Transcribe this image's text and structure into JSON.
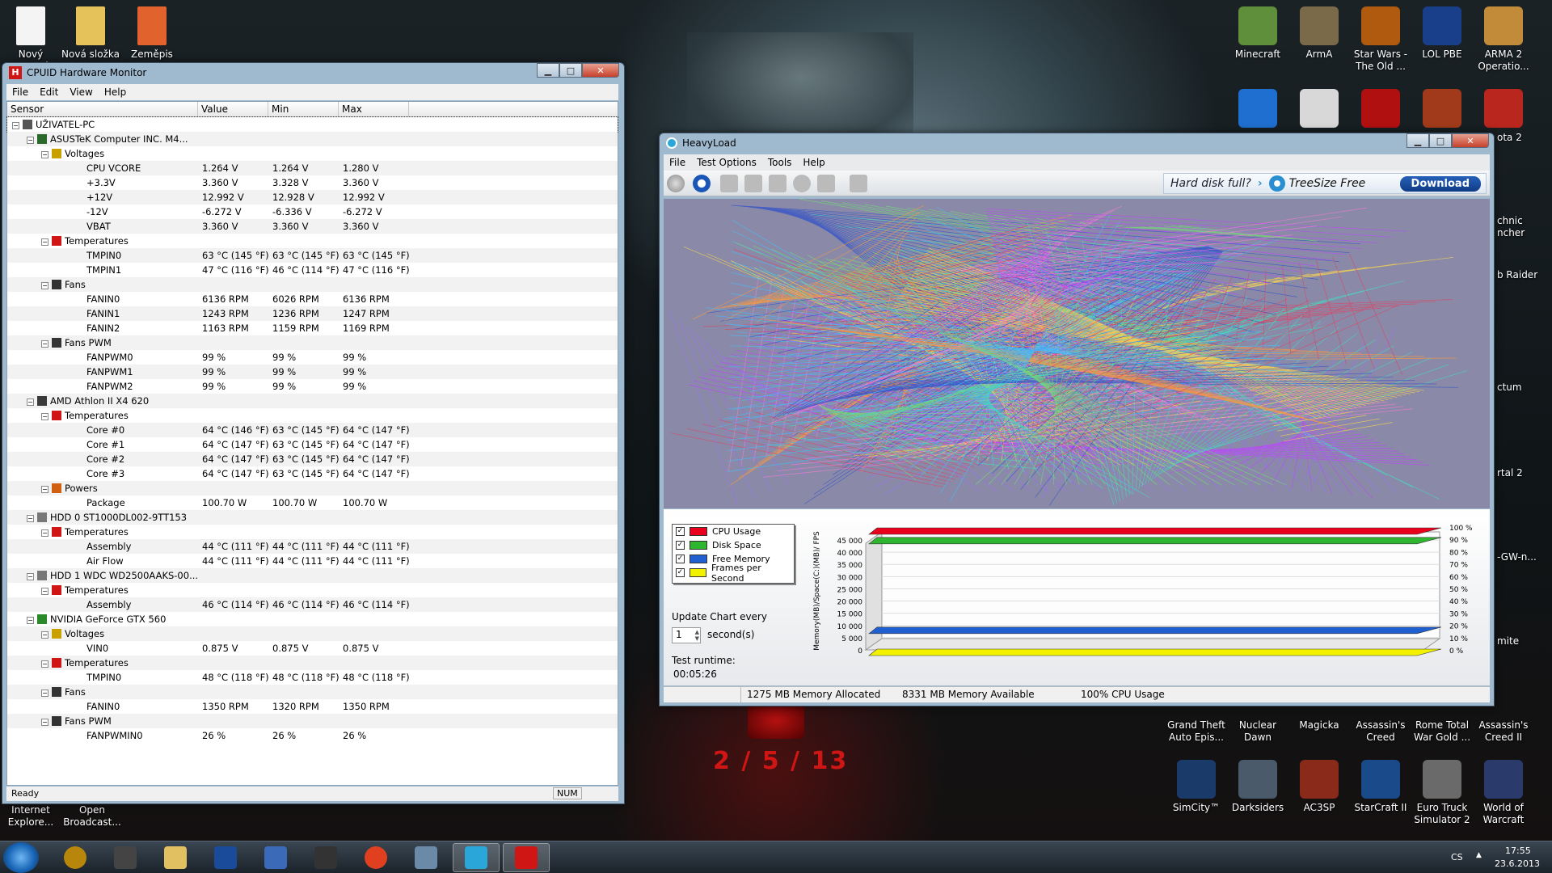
{
  "desktop_left_icons": [
    {
      "label": "Nový textový"
    },
    {
      "label": "Nová složka"
    },
    {
      "label": "Zeměpis"
    }
  ],
  "desktop_right_top": [
    {
      "label": "Minecraft"
    },
    {
      "label": "ArmA"
    },
    {
      "label": "Star Wars - The Old ..."
    },
    {
      "label": "LOL PBE"
    },
    {
      "label": "ARMA 2 Operatio..."
    }
  ],
  "desktop_right_bottom": [
    {
      "label": "Grand Theft Auto Epis..."
    },
    {
      "label": "Nuclear Dawn"
    },
    {
      "label": "Magicka"
    },
    {
      "label": "Assassin's Creed"
    },
    {
      "label": "Rome Total War Gold ..."
    },
    {
      "label": "Assassin's Creed II"
    },
    {
      "label": "SimCity™"
    },
    {
      "label": "Darksiders"
    },
    {
      "label": "AC3SP"
    },
    {
      "label": "StarCraft II"
    },
    {
      "label": "Euro Truck Simulator 2"
    },
    {
      "label": "World of Warcraft"
    }
  ],
  "desktop_partial_labels": [
    "ota 2",
    "chnic ncher",
    "b Raider",
    "ctum",
    "rtal 2",
    "-GW-n...",
    "mite"
  ],
  "desktop_bottom_left": [
    {
      "label": "Internet Explore..."
    },
    {
      "label": "Open Broadcast..."
    }
  ],
  "wallpaper_date": "2 / 5 / 13",
  "hwmon": {
    "title": "CPUID Hardware Monitor",
    "menu": [
      "File",
      "Edit",
      "View",
      "Help"
    ],
    "columns": [
      "Sensor",
      "Value",
      "Min",
      "Max"
    ],
    "rows": [
      {
        "lvl": 0,
        "name": "UŽIVATEL-PC",
        "v": "",
        "mn": "",
        "mx": "",
        "ico": "pc"
      },
      {
        "lvl": 1,
        "name": "ASUSTeK Computer INC. M4...",
        "v": "",
        "mn": "",
        "mx": "",
        "ico": "board"
      },
      {
        "lvl": 2,
        "name": "Voltages",
        "v": "",
        "mn": "",
        "mx": "",
        "ico": "volt"
      },
      {
        "lvl": 3,
        "name": "CPU VCORE",
        "v": "1.264 V",
        "mn": "1.264 V",
        "mx": "1.280 V"
      },
      {
        "lvl": 3,
        "name": "+3.3V",
        "v": "3.360 V",
        "mn": "3.328 V",
        "mx": "3.360 V"
      },
      {
        "lvl": 3,
        "name": "+12V",
        "v": "12.992 V",
        "mn": "12.928 V",
        "mx": "12.992 V"
      },
      {
        "lvl": 3,
        "name": "-12V",
        "v": "-6.272 V",
        "mn": "-6.336 V",
        "mx": "-6.272 V"
      },
      {
        "lvl": 3,
        "name": "VBAT",
        "v": "3.360 V",
        "mn": "3.360 V",
        "mx": "3.360 V"
      },
      {
        "lvl": 2,
        "name": "Temperatures",
        "v": "",
        "mn": "",
        "mx": "",
        "ico": "temp"
      },
      {
        "lvl": 3,
        "name": "TMPIN0",
        "v": "63 °C  (145 °F)",
        "mn": "63 °C  (145 °F)",
        "mx": "63 °C  (145 °F)"
      },
      {
        "lvl": 3,
        "name": "TMPIN1",
        "v": "47 °C  (116 °F)",
        "mn": "46 °C  (114 °F)",
        "mx": "47 °C  (116 °F)"
      },
      {
        "lvl": 2,
        "name": "Fans",
        "v": "",
        "mn": "",
        "mx": "",
        "ico": "fan"
      },
      {
        "lvl": 3,
        "name": "FANIN0",
        "v": "6136 RPM",
        "mn": "6026 RPM",
        "mx": "6136 RPM"
      },
      {
        "lvl": 3,
        "name": "FANIN1",
        "v": "1243 RPM",
        "mn": "1236 RPM",
        "mx": "1247 RPM"
      },
      {
        "lvl": 3,
        "name": "FANIN2",
        "v": "1163 RPM",
        "mn": "1159 RPM",
        "mx": "1169 RPM"
      },
      {
        "lvl": 2,
        "name": "Fans PWM",
        "v": "",
        "mn": "",
        "mx": "",
        "ico": "fan"
      },
      {
        "lvl": 3,
        "name": "FANPWM0",
        "v": "99 %",
        "mn": "99 %",
        "mx": "99 %"
      },
      {
        "lvl": 3,
        "name": "FANPWM1",
        "v": "99 %",
        "mn": "99 %",
        "mx": "99 %"
      },
      {
        "lvl": 3,
        "name": "FANPWM2",
        "v": "99 %",
        "mn": "99 %",
        "mx": "99 %"
      },
      {
        "lvl": 1,
        "name": "AMD Athlon II X4 620",
        "v": "",
        "mn": "",
        "mx": "",
        "ico": "cpu"
      },
      {
        "lvl": 2,
        "name": "Temperatures",
        "v": "",
        "mn": "",
        "mx": "",
        "ico": "temp"
      },
      {
        "lvl": 3,
        "name": "Core #0",
        "v": "64 °C  (146 °F)",
        "mn": "63 °C  (145 °F)",
        "mx": "64 °C  (147 °F)"
      },
      {
        "lvl": 3,
        "name": "Core #1",
        "v": "64 °C  (147 °F)",
        "mn": "63 °C  (145 °F)",
        "mx": "64 °C  (147 °F)"
      },
      {
        "lvl": 3,
        "name": "Core #2",
        "v": "64 °C  (147 °F)",
        "mn": "63 °C  (145 °F)",
        "mx": "64 °C  (147 °F)"
      },
      {
        "lvl": 3,
        "name": "Core #3",
        "v": "64 °C  (147 °F)",
        "mn": "63 °C  (145 °F)",
        "mx": "64 °C  (147 °F)"
      },
      {
        "lvl": 2,
        "name": "Powers",
        "v": "",
        "mn": "",
        "mx": "",
        "ico": "power"
      },
      {
        "lvl": 3,
        "name": "Package",
        "v": "100.70 W",
        "mn": "100.70 W",
        "mx": "100.70 W"
      },
      {
        "lvl": 1,
        "name": "HDD 0 ST1000DL002-9TT153",
        "v": "",
        "mn": "",
        "mx": "",
        "ico": "hdd"
      },
      {
        "lvl": 2,
        "name": "Temperatures",
        "v": "",
        "mn": "",
        "mx": "",
        "ico": "temp"
      },
      {
        "lvl": 3,
        "name": "Assembly",
        "v": "44 °C  (111 °F)",
        "mn": "44 °C  (111 °F)",
        "mx": "44 °C  (111 °F)"
      },
      {
        "lvl": 3,
        "name": "Air Flow",
        "v": "44 °C  (111 °F)",
        "mn": "44 °C  (111 °F)",
        "mx": "44 °C  (111 °F)"
      },
      {
        "lvl": 1,
        "name": "HDD 1 WDC WD2500AAKS-00...",
        "v": "",
        "mn": "",
        "mx": "",
        "ico": "hdd"
      },
      {
        "lvl": 2,
        "name": "Temperatures",
        "v": "",
        "mn": "",
        "mx": "",
        "ico": "temp"
      },
      {
        "lvl": 3,
        "name": "Assembly",
        "v": "46 °C  (114 °F)",
        "mn": "46 °C  (114 °F)",
        "mx": "46 °C  (114 °F)"
      },
      {
        "lvl": 1,
        "name": "NVIDIA GeForce GTX 560",
        "v": "",
        "mn": "",
        "mx": "",
        "ico": "gpu"
      },
      {
        "lvl": 2,
        "name": "Voltages",
        "v": "",
        "mn": "",
        "mx": "",
        "ico": "volt"
      },
      {
        "lvl": 3,
        "name": "VIN0",
        "v": "0.875 V",
        "mn": "0.875 V",
        "mx": "0.875 V"
      },
      {
        "lvl": 2,
        "name": "Temperatures",
        "v": "",
        "mn": "",
        "mx": "",
        "ico": "temp"
      },
      {
        "lvl": 3,
        "name": "TMPIN0",
        "v": "48 °C  (118 °F)",
        "mn": "48 °C  (118 °F)",
        "mx": "48 °C  (118 °F)"
      },
      {
        "lvl": 2,
        "name": "Fans",
        "v": "",
        "mn": "",
        "mx": "",
        "ico": "fan"
      },
      {
        "lvl": 3,
        "name": "FANIN0",
        "v": "1350 RPM",
        "mn": "1320 RPM",
        "mx": "1350 RPM"
      },
      {
        "lvl": 2,
        "name": "Fans PWM",
        "v": "",
        "mn": "",
        "mx": "",
        "ico": "fan"
      },
      {
        "lvl": 3,
        "name": "FANPWMIN0",
        "v": "26 %",
        "mn": "26 %",
        "mx": "26 %"
      }
    ],
    "status": "Ready",
    "status_num": "NUM"
  },
  "heavyload": {
    "title": "HeavyLoad",
    "menu": [
      "File",
      "Test Options",
      "Tools",
      "Help"
    ],
    "ad_text": "Hard disk full?",
    "ad_brand": "TreeSize Free",
    "ad_button": "Download",
    "legend": [
      {
        "label": "CPU Usage",
        "color": "#e8001c"
      },
      {
        "label": "Disk Space",
        "color": "#2fb52f"
      },
      {
        "label": "Free Memory",
        "color": "#1f5fd0"
      },
      {
        "label": "Frames per Second",
        "color": "#f2f200"
      }
    ],
    "update_label": "Update Chart every",
    "update_value": "1",
    "update_unit": "second(s)",
    "runtime_label": "Test runtime:",
    "runtime_value": "00:05:26",
    "status": [
      "1275 MB Memory Allocated",
      "8331 MB Memory Available",
      "100% CPU Usage"
    ]
  },
  "chart_data": {
    "type": "area",
    "left_axis_label": "Memory(MB)/Space(C:)(MB)/ FPS",
    "right_axis_label": "CPU Usage",
    "left_ticks": [
      "45 000",
      "40 000",
      "35 000",
      "30 000",
      "25 000",
      "20 000",
      "15 000",
      "10 000",
      "5 000",
      "0"
    ],
    "right_ticks": [
      "100 %",
      "90 %",
      "80 %",
      "70 %",
      "60 %",
      "50 %",
      "40 %",
      "30 %",
      "20 %",
      "10 %",
      "0 %"
    ],
    "series": [
      {
        "name": "CPU Usage",
        "value": 100,
        "unit": "%"
      },
      {
        "name": "Disk Space",
        "value": 93,
        "unit": "%"
      },
      {
        "name": "Free Memory",
        "value": 8331,
        "unit": "MB"
      },
      {
        "name": "Frames per Second",
        "value": 0,
        "unit": "FPS"
      }
    ]
  },
  "taskbar": {
    "lang": "CS",
    "time": "17:55",
    "date": "23.6.2013"
  }
}
